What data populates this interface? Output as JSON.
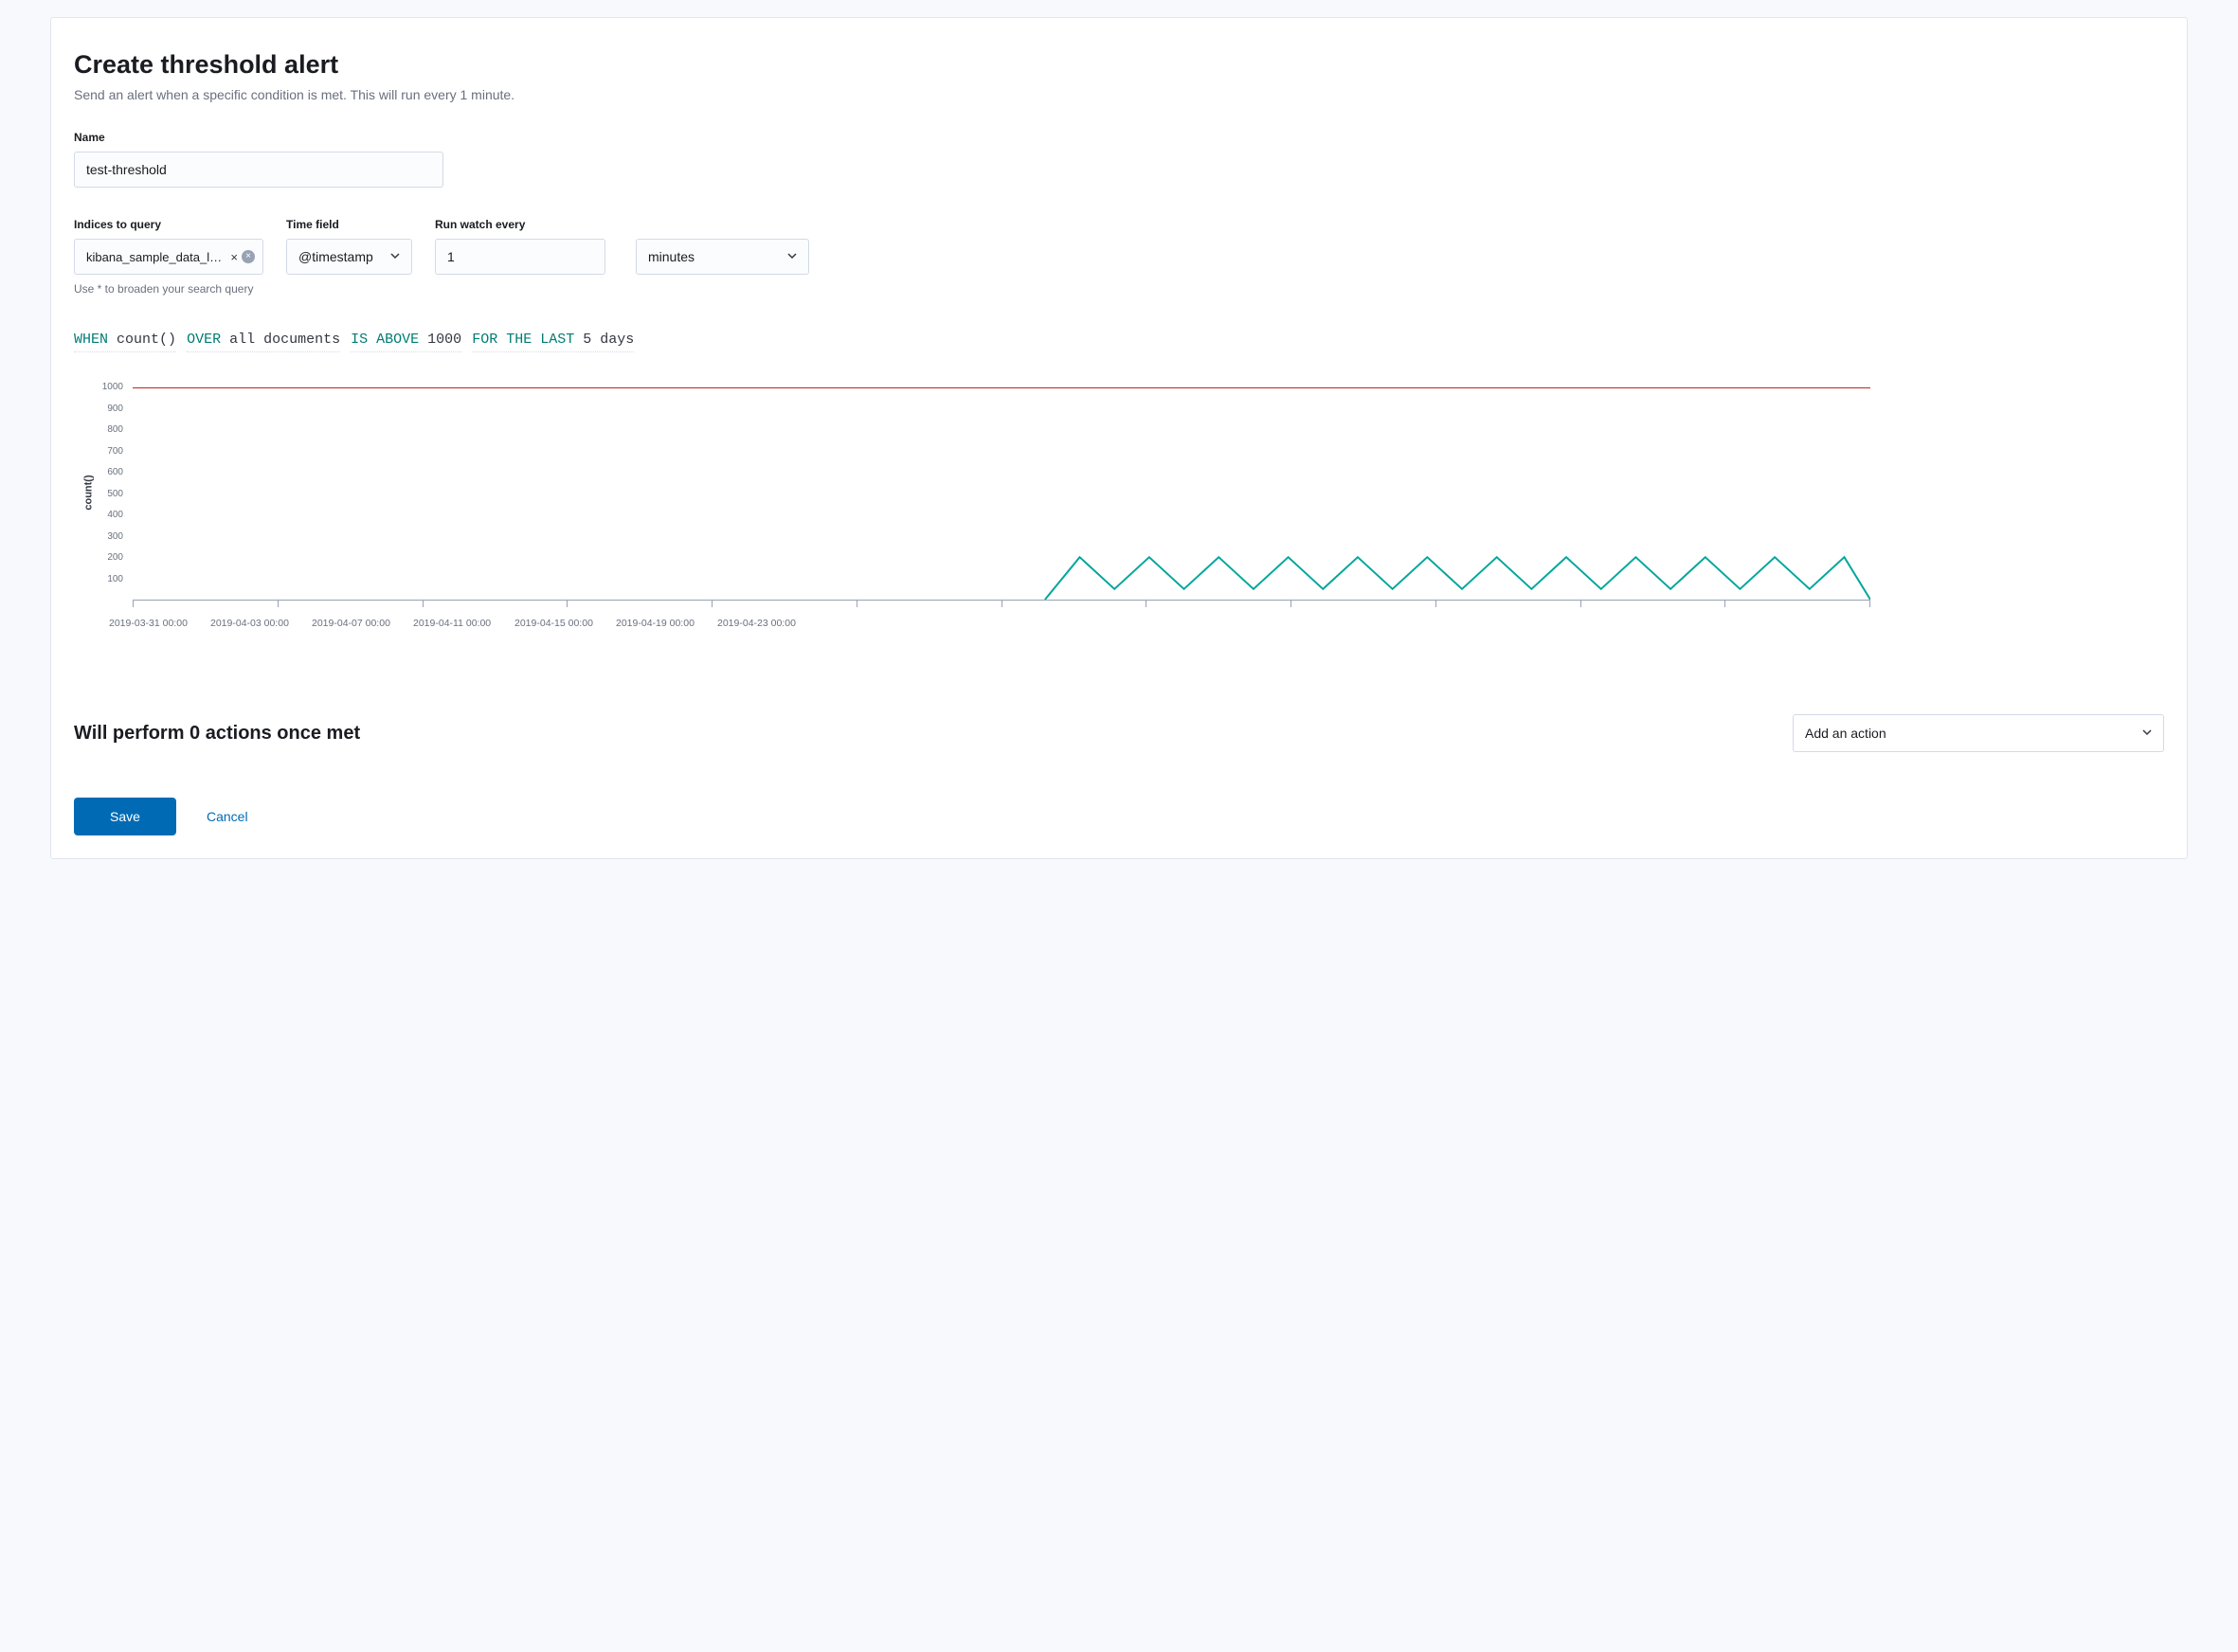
{
  "header": {
    "title": "Create threshold alert",
    "subtitle": "Send an alert when a specific condition is met. This will run every 1 minute."
  },
  "form": {
    "name_label": "Name",
    "name_value": "test-threshold",
    "indices_label": "Indices to query",
    "indices_value": "kibana_sample_data_logs",
    "indices_help": "Use * to broaden your search query",
    "timefield_label": "Time field",
    "timefield_value": "@timestamp",
    "run_every_label": "Run watch every",
    "run_every_value": "1",
    "run_every_unit": "minutes"
  },
  "expression": {
    "when_kw": "WHEN",
    "when_val": "count()",
    "over_kw": "OVER",
    "over_val": "all documents",
    "cond_kw": "IS ABOVE",
    "cond_val": "1000",
    "last_kw": "FOR THE LAST",
    "last_val": "5 days"
  },
  "chart_data": {
    "type": "line",
    "ylabel": "count()",
    "ylim": [
      0,
      1000
    ],
    "y_ticks": [
      "1000",
      "900",
      "800",
      "700",
      "600",
      "500",
      "400",
      "300",
      "200",
      "100"
    ],
    "x_ticks": [
      "2019-03-31 00:00",
      "2019-04-03 00:00",
      "2019-04-07 00:00",
      "2019-04-11 00:00",
      "2019-04-15 00:00",
      "2019-04-19 00:00",
      "2019-04-23 00:00"
    ],
    "x_tick_count": 13,
    "threshold": 1000,
    "series": [
      {
        "name": "count()",
        "color": "#00a69b",
        "data": [
          {
            "x": 0.525,
            "y": 0
          },
          {
            "x": 0.545,
            "y": 200
          },
          {
            "x": 0.565,
            "y": 50
          },
          {
            "x": 0.585,
            "y": 200
          },
          {
            "x": 0.605,
            "y": 50
          },
          {
            "x": 0.625,
            "y": 200
          },
          {
            "x": 0.645,
            "y": 50
          },
          {
            "x": 0.665,
            "y": 200
          },
          {
            "x": 0.685,
            "y": 50
          },
          {
            "x": 0.705,
            "y": 200
          },
          {
            "x": 0.725,
            "y": 50
          },
          {
            "x": 0.745,
            "y": 200
          },
          {
            "x": 0.765,
            "y": 50
          },
          {
            "x": 0.785,
            "y": 200
          },
          {
            "x": 0.805,
            "y": 50
          },
          {
            "x": 0.825,
            "y": 200
          },
          {
            "x": 0.845,
            "y": 50
          },
          {
            "x": 0.865,
            "y": 200
          },
          {
            "x": 0.885,
            "y": 50
          },
          {
            "x": 0.905,
            "y": 200
          },
          {
            "x": 0.925,
            "y": 50
          },
          {
            "x": 0.945,
            "y": 200
          },
          {
            "x": 0.965,
            "y": 50
          },
          {
            "x": 0.985,
            "y": 200
          },
          {
            "x": 1.0,
            "y": 0
          }
        ]
      }
    ]
  },
  "actions": {
    "title": "Will perform 0 actions once met",
    "add_action_label": "Add an action"
  },
  "footer": {
    "save_label": "Save",
    "cancel_label": "Cancel"
  }
}
